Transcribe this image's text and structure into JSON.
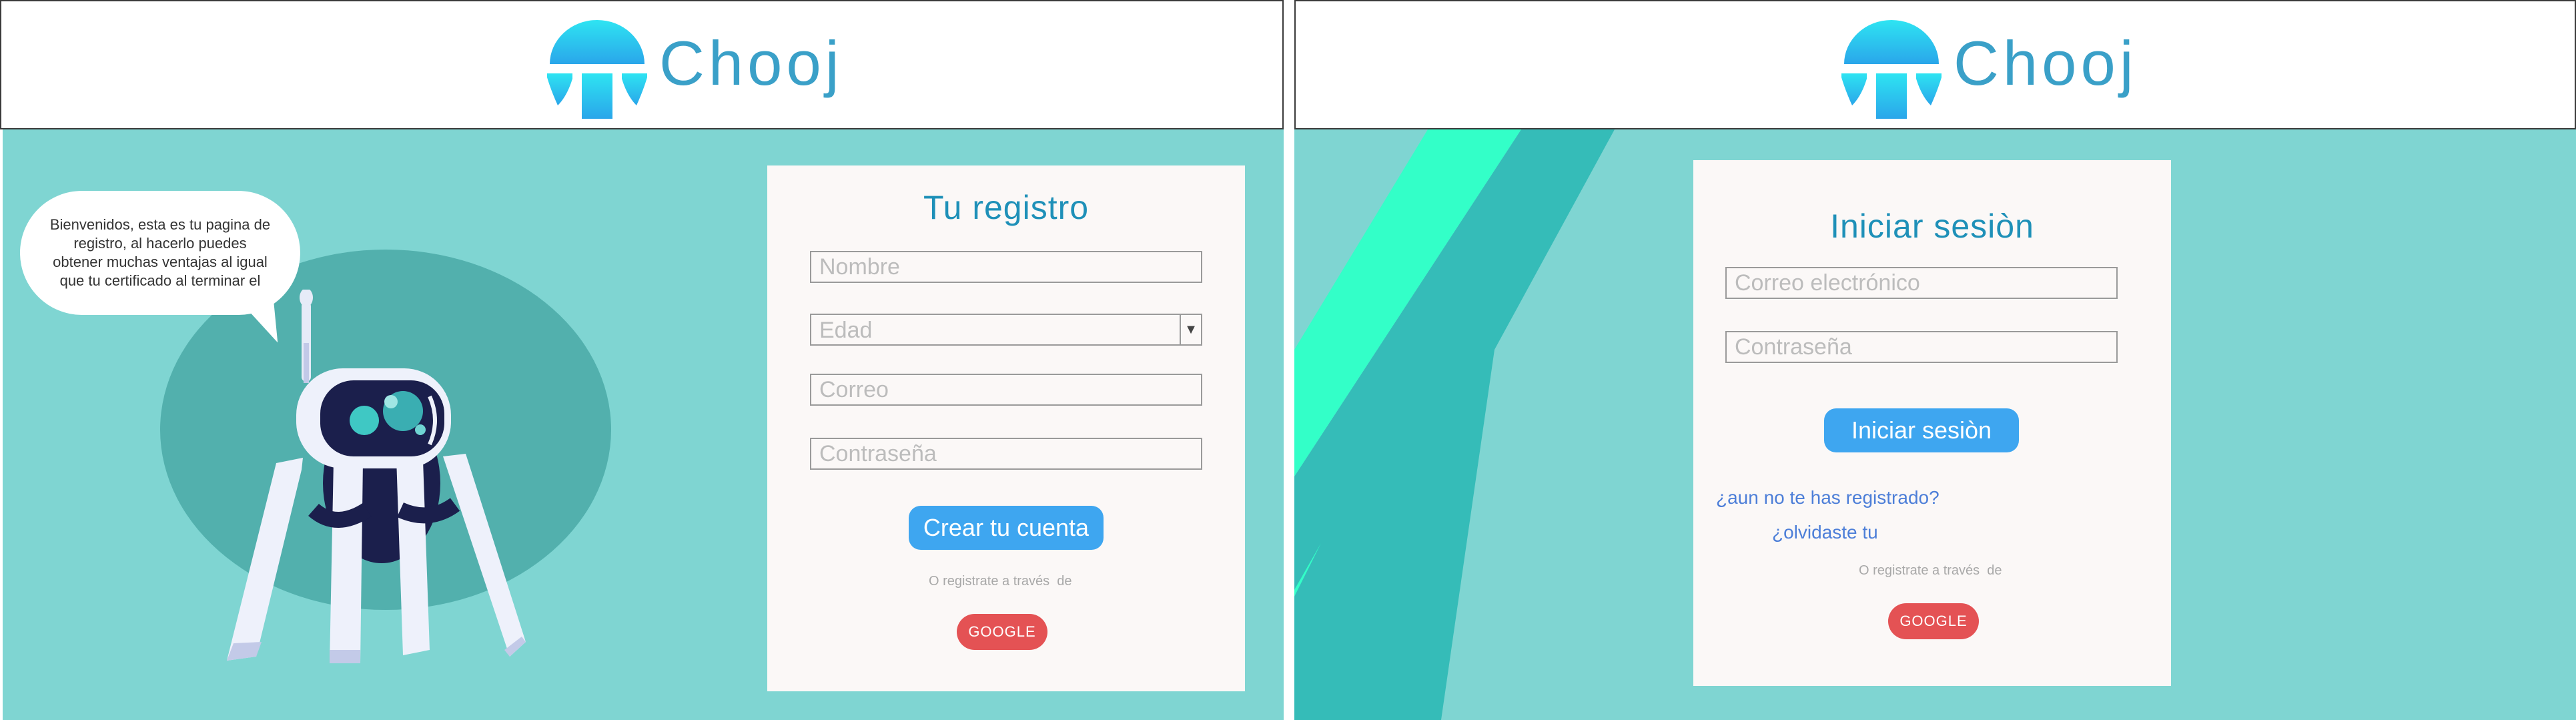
{
  "brand": {
    "name": "Chooj",
    "logo_icon": "jellyfish-logo-icon",
    "colors": {
      "logo_text": "#3aa0c8",
      "logo_gradient_top": "#2ee0f0",
      "logo_gradient_bottom": "#2aa8ec"
    }
  },
  "register_page": {
    "bubble_text": "Bienvenidos, esta es tu pagina de registro, al hacerlo puedes obtener muchas ventajas al igual que tu certificado al terminar el",
    "mascot": "robot-mascot",
    "title": "Tu registro",
    "fields": {
      "name_placeholder": "Nombre",
      "age_value": "Edad",
      "age_arrow": "▼",
      "email_placeholder": "Correo",
      "password_placeholder": "Contraseña"
    },
    "create_button": "Crear tu cuenta",
    "alt_text": "O registrate a través  de",
    "google_button": "GOOGLE"
  },
  "login_page": {
    "title": "Iniciar sesiòn",
    "fields": {
      "email_placeholder": "Correo electrónico",
      "password_placeholder": "Contraseña"
    },
    "login_button": "Iniciar sesiòn",
    "register_link": "¿aun no te has registrado?",
    "forgot_link": "¿olvidaste tu",
    "alt_text": "O registrate a través  de",
    "google_button": "GOOGLE"
  },
  "colors": {
    "background": "#7fd5d2",
    "blob": "#52b0ad",
    "card": "#fbf8f7",
    "title": "#1e90b8",
    "primary_button": "#3ea6f0",
    "google_button": "#e45254",
    "stripe_light": "#33ffc8",
    "stripe_dark": "#35bcb8",
    "link": "#4c7ed8"
  }
}
